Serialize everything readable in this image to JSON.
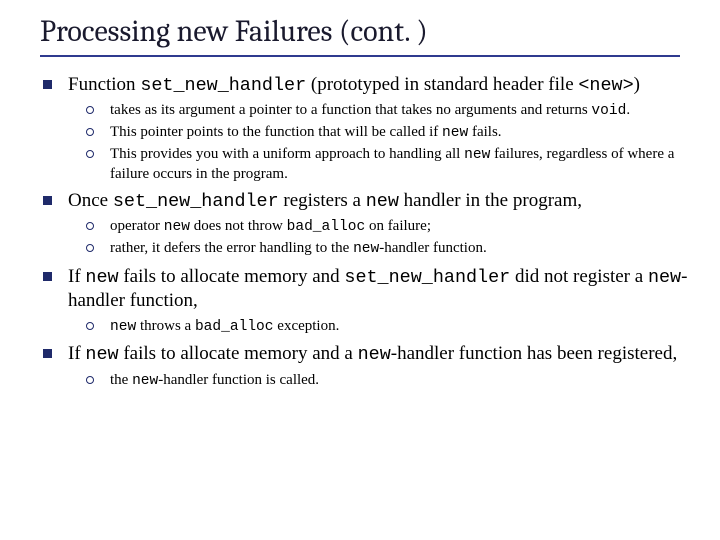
{
  "title": "Processing new Failures (cont. )",
  "b1": {
    "pre": "Function ",
    "c1": "set_new_handler",
    "mid": " (prototyped in standard header file ",
    "c2": "<new>",
    "post": ")",
    "s1": {
      "pre": "takes as its argument a pointer to a function that takes no arguments and returns ",
      "c1": "void",
      "post": "."
    },
    "s2": {
      "pre": "This pointer points to the function that will be called if ",
      "c1": "new",
      "post": " fails."
    },
    "s3": {
      "pre": "This provides you with a uniform approach to handling all ",
      "c1": "new",
      "post": " failures, regardless of where a failure occurs in the program."
    }
  },
  "b2": {
    "pre": "Once ",
    "c1": "set_new_handler",
    "mid": " registers a ",
    "c2": "new",
    "post": " handler in the program,",
    "s1": {
      "pre": "operator ",
      "c1": "new",
      "mid": " does not throw ",
      "c2": "bad_alloc",
      "post": " on failure;"
    },
    "s2": {
      "pre": "rather, it defers the error handling to the ",
      "c1": "new",
      "post": "-handler function."
    }
  },
  "b3": {
    "pre": "If ",
    "c1": "new",
    "mid": " fails to allocate memory and ",
    "c2": "set_new_handler",
    "mid2": " did not register a ",
    "c3": "new",
    "post": "-handler function,",
    "s1": {
      "c1": "new",
      "mid": " throws a ",
      "c2": "bad_alloc",
      "post": " exception."
    }
  },
  "b4": {
    "pre": "If ",
    "c1": "new",
    "mid": " fails to allocate memory and a ",
    "c2": "new",
    "post": "-handler function has been registered,",
    "s1": {
      "pre": "the ",
      "c1": "new",
      "post": "-handler function is called."
    }
  }
}
